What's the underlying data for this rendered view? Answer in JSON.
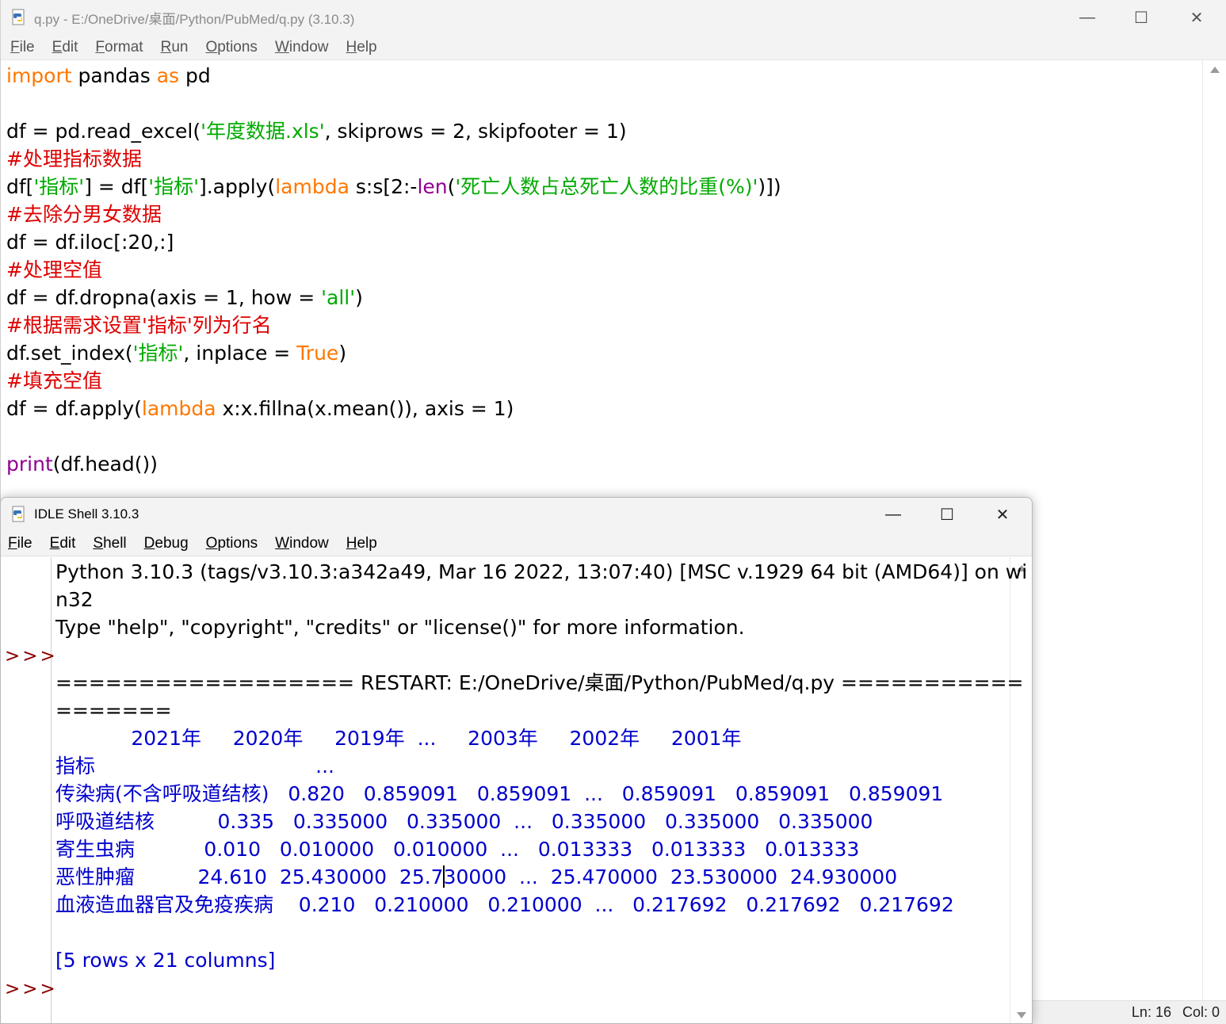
{
  "editor": {
    "title": "q.py - E:/OneDrive/桌面/Python/PubMed/q.py (3.10.3)",
    "menu": [
      "File",
      "Edit",
      "Format",
      "Run",
      "Options",
      "Window",
      "Help"
    ],
    "code_lines": [
      [
        {
          "t": "import",
          "c": "kw"
        },
        {
          "t": " pandas ",
          "c": ""
        },
        {
          "t": "as",
          "c": "kw"
        },
        {
          "t": " pd",
          "c": ""
        }
      ],
      [],
      [
        {
          "t": "df = pd.read_excel(",
          "c": ""
        },
        {
          "t": "'年度数据.xls'",
          "c": "st"
        },
        {
          "t": ", skiprows = 2, skipfooter = 1)",
          "c": ""
        }
      ],
      [
        {
          "t": "#处理指标数据",
          "c": "cm"
        }
      ],
      [
        {
          "t": "df[",
          "c": ""
        },
        {
          "t": "'指标'",
          "c": "st"
        },
        {
          "t": "] = df[",
          "c": ""
        },
        {
          "t": "'指标'",
          "c": "st"
        },
        {
          "t": "].apply(",
          "c": ""
        },
        {
          "t": "lambda",
          "c": "kw"
        },
        {
          "t": " s:s[2:-",
          "c": ""
        },
        {
          "t": "len",
          "c": "bi"
        },
        {
          "t": "(",
          "c": ""
        },
        {
          "t": "'死亡人数占总死亡人数的比重(%)'",
          "c": "st"
        },
        {
          "t": ")])",
          "c": ""
        }
      ],
      [
        {
          "t": "#去除分男女数据",
          "c": "cm"
        }
      ],
      [
        {
          "t": "df = df.iloc[:20,:]",
          "c": ""
        }
      ],
      [
        {
          "t": "#处理空值",
          "c": "cm"
        }
      ],
      [
        {
          "t": "df = df.dropna(axis = 1, how = ",
          "c": ""
        },
        {
          "t": "'all'",
          "c": "st"
        },
        {
          "t": ")",
          "c": ""
        }
      ],
      [
        {
          "t": "#根据需求设置'指标'列为行名",
          "c": "cm"
        }
      ],
      [
        {
          "t": "df.set_index(",
          "c": ""
        },
        {
          "t": "'指标'",
          "c": "st"
        },
        {
          "t": ", inplace = ",
          "c": ""
        },
        {
          "t": "True",
          "c": "kw"
        },
        {
          "t": ")",
          "c": ""
        }
      ],
      [
        {
          "t": "#填充空值",
          "c": "cm"
        }
      ],
      [
        {
          "t": "df = df.apply(",
          "c": ""
        },
        {
          "t": "lambda",
          "c": "kw"
        },
        {
          "t": " x:x.fillna(x.mean()), axis = 1)",
          "c": ""
        }
      ],
      [],
      [
        {
          "t": "print",
          "c": "bi"
        },
        {
          "t": "(df.head())",
          "c": ""
        }
      ]
    ],
    "status": {
      "ln": "Ln: 16",
      "col": "Col: 0"
    }
  },
  "shell": {
    "title": "IDLE Shell 3.10.3",
    "menu": [
      "File",
      "Edit",
      "Shell",
      "Debug",
      "Options",
      "Window",
      "Help"
    ],
    "prompt": ">>>",
    "lines": [
      {
        "t": "Python 3.10.3 (tags/v3.10.3:a342a49, Mar 16 2022, 13:07:40) [MSC v.1929 64 bit (AMD64)] on wi",
        "c": ""
      },
      {
        "t": "n32",
        "c": ""
      },
      {
        "t": "Type \"help\", \"copyright\", \"credits\" or \"license()\" for more information.",
        "c": ""
      },
      {
        "t": "",
        "c": ""
      },
      {
        "t": "================== RESTART: E:/OneDrive/桌面/Python/PubMed/q.py ===========",
        "c": ""
      },
      {
        "t": "=======",
        "c": ""
      },
      {
        "t": "            2021年     2020年     2019年  ...     2003年     2002年     2001年",
        "c": "out"
      },
      {
        "t": "指标                                   ...",
        "c": "out"
      },
      {
        "t": "传染病(不含呼吸道结核)   0.820   0.859091   0.859091  ...   0.859091   0.859091   0.859091",
        "c": "out"
      },
      {
        "t": "呼吸道结核          0.335   0.335000   0.335000  ...   0.335000   0.335000   0.335000",
        "c": "out"
      },
      {
        "t": "寄生虫病           0.010   0.010000   0.010000  ...   0.013333   0.013333   0.013333",
        "c": "out"
      },
      {
        "t": "恶性肿瘤          24.610  25.430000  25.730000  ...  25.470000  23.530000  24.930000",
        "c": "out",
        "cursor_after": 3
      },
      {
        "t": "血液造血器官及免疫疾病    0.210   0.210000   0.210000  ...   0.217692   0.217692   0.217692",
        "c": "out"
      },
      {
        "t": "",
        "c": ""
      },
      {
        "t": "[5 rows x 21 columns]",
        "c": "out"
      }
    ]
  }
}
